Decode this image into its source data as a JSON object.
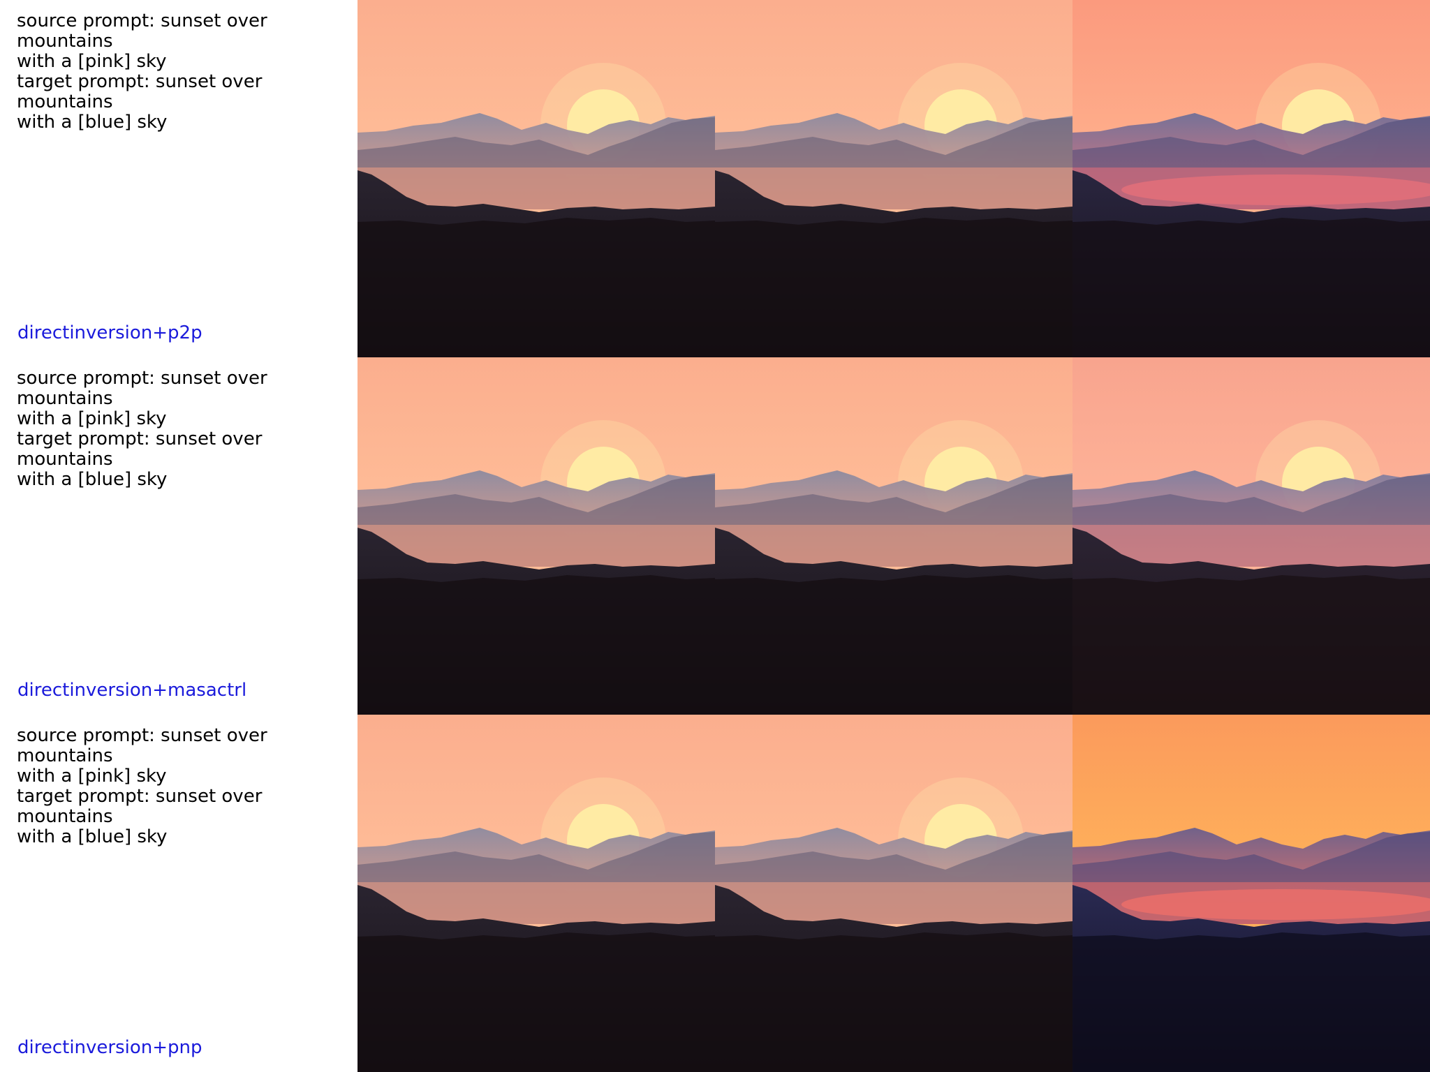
{
  "rows": [
    {
      "prompt_text": "source prompt: sunset over mountains\nwith a [pink] sky\ntarget prompt: sunset over mountains\nwith a [blue] sky",
      "method_label": "directinversion+p2p",
      "method_color": "#1a1adb",
      "images": [
        {
          "variant": "pink",
          "sky_top": "#fbae8e",
          "sky_mid": "#ffbf99",
          "sky_low": "#ffb590",
          "haze": "#f0a085",
          "ridge_far": "#8c8aa0",
          "ridge_mid": "#5e5a72",
          "ridge_near": "#2a2430",
          "ground": "#140e12",
          "sun": true,
          "glow_band": false
        },
        {
          "variant": "pink",
          "sky_top": "#fbae8e",
          "sky_mid": "#ffbf99",
          "sky_low": "#ffb590",
          "haze": "#f0a085",
          "ridge_far": "#8c8aa0",
          "ridge_mid": "#5e5a72",
          "ridge_near": "#2a2430",
          "ground": "#140e12",
          "sun": true,
          "glow_band": false
        },
        {
          "variant": "edited",
          "sky_top": "#fb9a7e",
          "sky_mid": "#ffb28e",
          "sky_low": "#ffb08a",
          "haze": "#e8707a",
          "ridge_far": "#6f6f98",
          "ridge_mid": "#4a4a78",
          "ridge_near": "#2a2640",
          "ground": "#140e14",
          "sun": true,
          "glow_band": true
        }
      ]
    },
    {
      "prompt_text": "source prompt: sunset over mountains\nwith a [pink] sky\ntarget prompt: sunset over mountains\nwith a [blue] sky",
      "method_label": "directinversion+masactrl",
      "method_color": "#1a1adb",
      "images": [
        {
          "variant": "pink",
          "sky_top": "#fbae8e",
          "sky_mid": "#ffbf99",
          "sky_low": "#ffb590",
          "haze": "#f0a085",
          "ridge_far": "#8c8aa0",
          "ridge_mid": "#5e5a72",
          "ridge_near": "#2a2430",
          "ground": "#140e12",
          "sun": true,
          "glow_band": false
        },
        {
          "variant": "pink",
          "sky_top": "#fbae8e",
          "sky_mid": "#ffbf99",
          "sky_low": "#ffb590",
          "haze": "#f0a085",
          "ridge_far": "#8c8aa0",
          "ridge_mid": "#5e5a72",
          "ridge_near": "#2a2430",
          "ground": "#140e12",
          "sun": true,
          "glow_band": false
        },
        {
          "variant": "edited",
          "sky_top": "#f8a48e",
          "sky_mid": "#ffb69a",
          "sky_low": "#ffa88e",
          "haze": "#ec8a86",
          "ridge_far": "#7e7ea0",
          "ridge_mid": "#555478",
          "ridge_near": "#2c2434",
          "ground": "#1a1014",
          "sun": true,
          "glow_band": false
        }
      ]
    },
    {
      "prompt_text": "source prompt: sunset over mountains\nwith a [pink] sky\ntarget prompt: sunset over mountains\nwith a [blue] sky",
      "method_label": "directinversion+pnp",
      "method_color": "#1a1adb",
      "images": [
        {
          "variant": "pink",
          "sky_top": "#fbae8e",
          "sky_mid": "#ffbf99",
          "sky_low": "#ffb590",
          "haze": "#f0a085",
          "ridge_far": "#8c8aa0",
          "ridge_mid": "#5e5a72",
          "ridge_near": "#2a2430",
          "ground": "#140e12",
          "sun": true,
          "glow_band": false
        },
        {
          "variant": "pink",
          "sky_top": "#fbae8e",
          "sky_mid": "#ffbf99",
          "sky_low": "#ffb590",
          "haze": "#f0a085",
          "ridge_far": "#8c8aa0",
          "ridge_mid": "#5e5a72",
          "ridge_near": "#2a2430",
          "ground": "#140e12",
          "sun": true,
          "glow_band": false
        },
        {
          "variant": "pnp",
          "sky_top": "#fb9a5c",
          "sky_mid": "#ffb45a",
          "sky_low": "#f79a60",
          "haze": "#f0706a",
          "ridge_far": "#6a5e8c",
          "ridge_mid": "#464478",
          "ridge_near": "#2a2a52",
          "ground": "#0e0c1c",
          "sun": false,
          "glow_band": true
        }
      ]
    }
  ]
}
